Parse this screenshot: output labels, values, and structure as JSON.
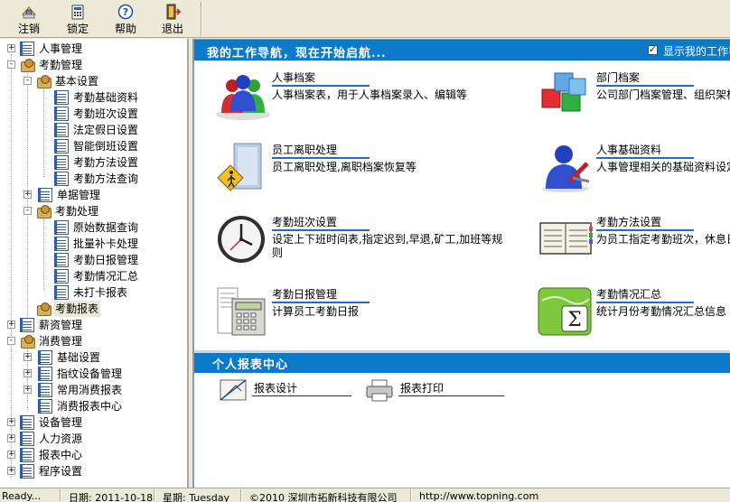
{
  "toolbar": {
    "buttons": [
      {
        "label": "注销",
        "icon": "logout-icon"
      },
      {
        "label": "锁定",
        "icon": "lock-icon"
      },
      {
        "label": "帮助",
        "icon": "help-icon"
      },
      {
        "label": "退出",
        "icon": "exit-icon"
      }
    ]
  },
  "tree": {
    "items": [
      {
        "label": "人事管理",
        "icon": "doc",
        "expander": "+"
      },
      {
        "label": "考勤管理",
        "icon": "folder",
        "expander": "-"
      },
      {
        "label": "基本设置",
        "icon": "folder",
        "expander": "-"
      },
      {
        "label": "考勤基础资料",
        "icon": "doc"
      },
      {
        "label": "考勤班次设置",
        "icon": "doc"
      },
      {
        "label": "法定假日设置",
        "icon": "doc"
      },
      {
        "label": "智能倒班设置",
        "icon": "doc"
      },
      {
        "label": "考勤方法设置",
        "icon": "doc"
      },
      {
        "label": "考勤方法查询",
        "icon": "doc"
      },
      {
        "label": "单据管理",
        "icon": "doc",
        "expander": "+"
      },
      {
        "label": "考勤处理",
        "icon": "folder",
        "expander": "-"
      },
      {
        "label": "原始数据查询",
        "icon": "doc"
      },
      {
        "label": "批量补卡处理",
        "icon": "doc"
      },
      {
        "label": "考勤日报管理",
        "icon": "doc"
      },
      {
        "label": "考勤情况汇总",
        "icon": "doc"
      },
      {
        "label": "未打卡报表",
        "icon": "doc"
      },
      {
        "label": "考勤报表",
        "icon": "folder",
        "selected": true
      },
      {
        "label": "薪资管理",
        "icon": "doc",
        "expander": "+"
      },
      {
        "label": "消费管理",
        "icon": "folder",
        "expander": "-"
      },
      {
        "label": "基础设置",
        "icon": "doc",
        "expander": "+"
      },
      {
        "label": "指纹设备管理",
        "icon": "doc",
        "expander": "+"
      },
      {
        "label": "常用消费报表",
        "icon": "doc",
        "expander": "+"
      },
      {
        "label": "消费报表中心",
        "icon": "doc"
      },
      {
        "label": "设备管理",
        "icon": "doc",
        "expander": "+"
      },
      {
        "label": "人力资源",
        "icon": "doc",
        "expander": "+"
      },
      {
        "label": "报表中心",
        "icon": "doc",
        "expander": "+"
      },
      {
        "label": "程序设置",
        "icon": "doc",
        "expander": "+"
      }
    ]
  },
  "nav": {
    "title": "我的工作导航，现在开始启航...",
    "show_label": "显示我的工作导",
    "items": [
      {
        "title": "人事档案",
        "desc": "人事档案表，用于人事档案录入、编辑等",
        "icon": "people-icon"
      },
      {
        "title": "部门档案",
        "desc": "公司部门档案管理、组织架构",
        "icon": "cubes-icon"
      },
      {
        "title": "员工离职处理",
        "desc": "员工离职处理,离职档案恢复等",
        "icon": "exit-door-icon"
      },
      {
        "title": "人事基础资料",
        "desc": "人事管理相关的基础资料设定",
        "icon": "user-tools-icon"
      },
      {
        "title": "考勤班次设置",
        "desc": "设定上下班时间表,指定迟到,早退,矿工,加班等规则",
        "icon": "clock-icon"
      },
      {
        "title": "考勤方法设置",
        "desc": "为员工指定考勤班次，休息日",
        "icon": "planner-icon"
      },
      {
        "title": "考勤日报管理",
        "desc": "计算员工考勤日报",
        "icon": "calculator-icon"
      },
      {
        "title": "考勤情况汇总",
        "desc": "统计月份考勤情况汇总信息",
        "icon": "sigma-icon"
      }
    ]
  },
  "report_center": {
    "title": "个人报表中心",
    "items": [
      {
        "label": "报表设计",
        "icon": "report-design-icon"
      },
      {
        "label": "报表打印",
        "icon": "printer-icon"
      }
    ]
  },
  "status": {
    "ready": "Ready...",
    "date": "日期: 2011-10-18",
    "weekday": "星期: Tuesday",
    "copyright": "©2010 深圳市拓新科技有限公司",
    "url": "http://www.topning.com"
  }
}
